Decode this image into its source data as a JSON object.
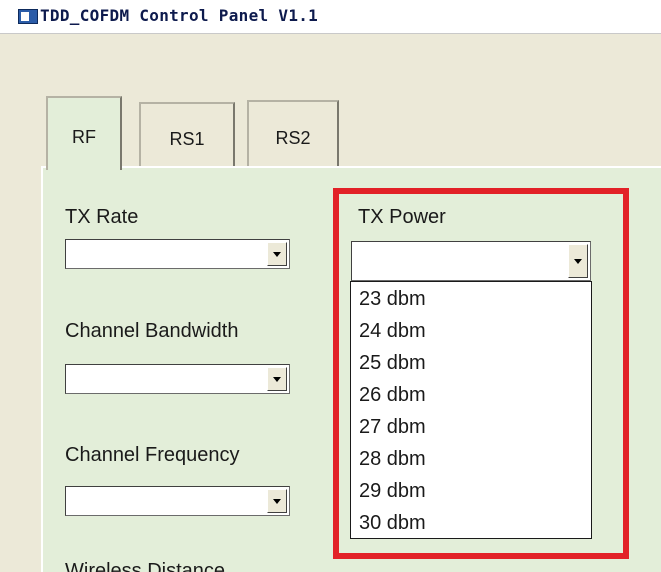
{
  "window": {
    "title": "TDD_COFDM Control Panel V1.1"
  },
  "tabs": [
    "RF",
    "RS1",
    "RS2"
  ],
  "rf_tab": {
    "tx_rate": {
      "label": "TX Rate",
      "value": ""
    },
    "tx_power": {
      "label": "TX Power",
      "value": "",
      "options": [
        "23 dbm",
        "24 dbm",
        "25 dbm",
        "26 dbm",
        "27 dbm",
        "28 dbm",
        "29 dbm",
        "30 dbm"
      ]
    },
    "channel_bandwidth": {
      "label": "Channel Bandwidth",
      "value": ""
    },
    "channel_frequency": {
      "label": "Channel Frequency",
      "value": ""
    },
    "wireless_distance": {
      "label": "Wireless Distance"
    }
  },
  "colors": {
    "highlight": "#e22127",
    "panel": "#e3eed9",
    "window": "#ece9d8"
  },
  "icons": [
    "app-icon",
    "chevron-down-icon"
  ]
}
